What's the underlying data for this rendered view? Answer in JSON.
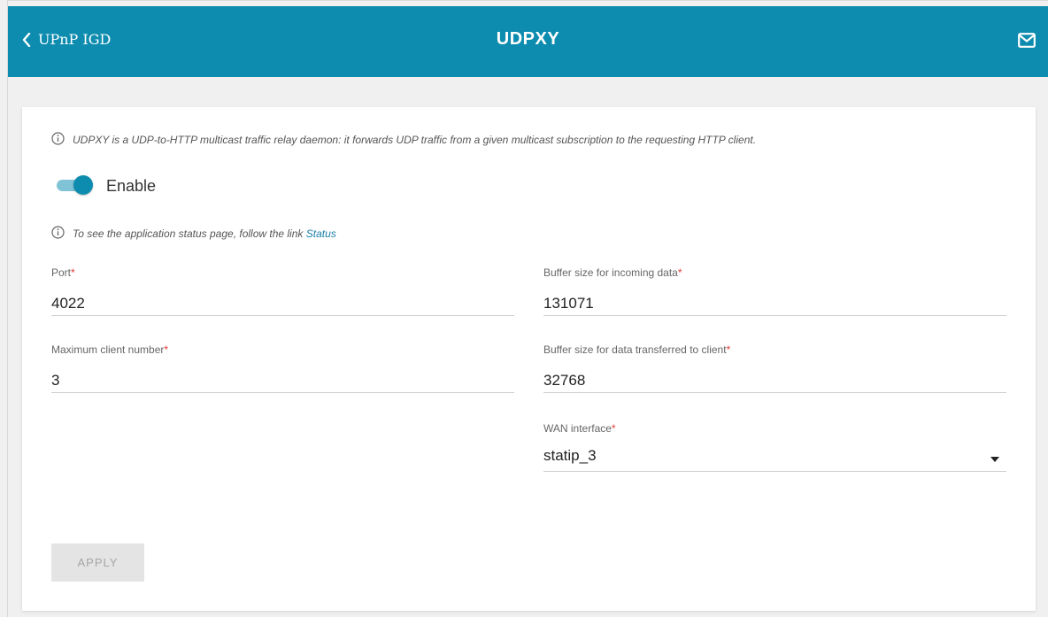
{
  "header": {
    "back_label": "UPnP IGD",
    "title": "UDPXY",
    "back_icon": "chevron-left-icon",
    "mail_icon": "mail-icon",
    "background": "#0d8caf"
  },
  "description": "UDPXY is a UDP-to-HTTP multicast traffic relay daemon: it forwards UDP traffic from a given multicast subscription to the requesting HTTP client.",
  "enable": {
    "label": "Enable",
    "state": "on"
  },
  "status_hint": {
    "text": "To see the application status page, follow the link ",
    "link_label": "Status"
  },
  "fields": {
    "port": {
      "label": "Port",
      "value": "4022"
    },
    "max_clients": {
      "label": "Maximum client number",
      "value": "3"
    },
    "buffer_in": {
      "label": "Buffer size for incoming data",
      "value": "131071"
    },
    "buffer_client": {
      "label": "Buffer size for data transferred to client",
      "value": "32768"
    },
    "wan_interface": {
      "label": "WAN interface",
      "value": "statip_3"
    }
  },
  "required_mark": "*",
  "apply_label": "APPLY"
}
